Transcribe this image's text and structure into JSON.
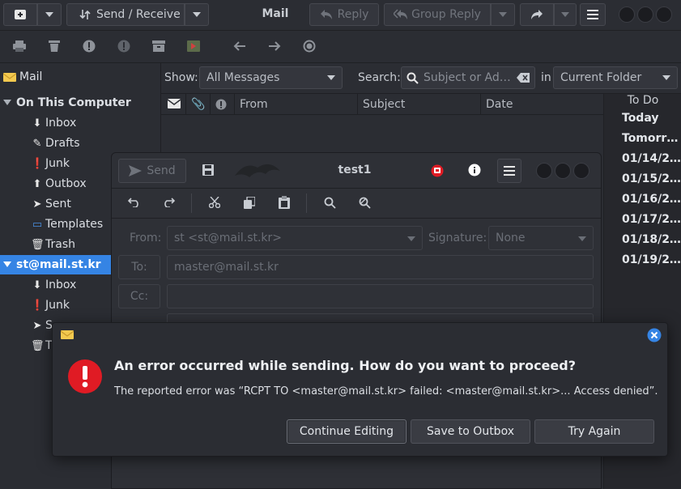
{
  "toolbar": {
    "send_receive_label": "Send / Receive",
    "window_title": "Mail",
    "reply_label": "Reply",
    "group_reply_label": "Group Reply"
  },
  "sidebar": {
    "header": "Mail",
    "local_account": "On This Computer",
    "local_folders": [
      "Inbox",
      "Drafts",
      "Junk",
      "Outbox",
      "Sent",
      "Templates",
      "Trash"
    ],
    "remote_account": "st@mail.st.kr",
    "remote_folders": [
      "Inbox",
      "Junk",
      "S",
      "T"
    ]
  },
  "filter": {
    "show_label": "Show:",
    "show_value": "All Messages",
    "search_label": "Search:",
    "search_placeholder": "Subject or Ad…",
    "in_label": "in",
    "scope_value": "Current Folder"
  },
  "columns": {
    "from": "From",
    "subject": "Subject",
    "date": "Date"
  },
  "todo": {
    "header": "To Do",
    "items": [
      "Today",
      "Tomorr…",
      "01/14/2…",
      "01/15/2…",
      "01/16/2…",
      "01/17/2…",
      "01/18/2…",
      "01/19/2…"
    ]
  },
  "composer": {
    "title": "test1",
    "send_label": "Send",
    "from_label": "From:",
    "from_value": "st <st@mail.st.kr>",
    "signature_label": "Signature:",
    "signature_value": "None",
    "to_label": "To:",
    "to_value": "master@mail.st.kr",
    "cc_label": "Cc:",
    "cc_value": ""
  },
  "dialog": {
    "title": "An error occurred while sending. How do you want to proceed?",
    "message": "The reported error was “RCPT TO <master@mail.st.kr> failed: <master@mail.st.kr>... Access denied”.",
    "continue_label": "Continue Editing",
    "outbox_label": "Save to Outbox",
    "retry_label": "Try Again"
  },
  "colors": {
    "background": "#2b2d33",
    "selection": "#3584e4",
    "error_red": "#e01b24",
    "close_blue": "#3584e4"
  }
}
